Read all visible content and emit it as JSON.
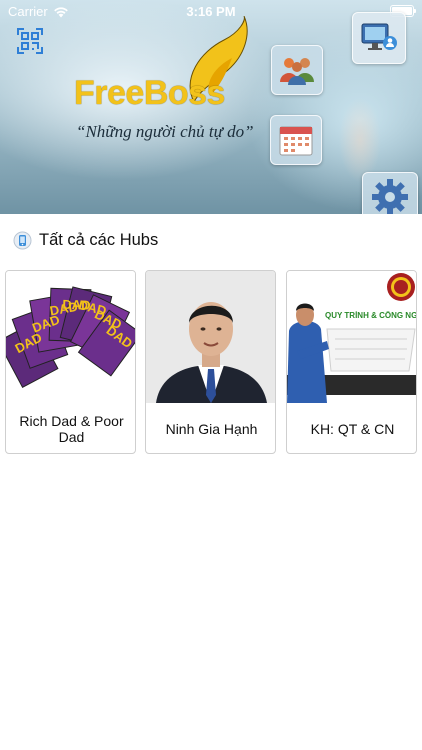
{
  "status_bar": {
    "carrier": "Carrier",
    "time": "3:16 PM"
  },
  "hero": {
    "logo_text": "FreeBoss",
    "tagline": "“Những người chủ tự do”",
    "icons": [
      "qr-scan-icon",
      "users-icon",
      "calendar-icon",
      "monitor-icon",
      "gear-icon"
    ]
  },
  "section": {
    "title": "Tất cả các Hubs",
    "icon": "hub-icon"
  },
  "hubs": [
    {
      "label": "Rich Dad & Poor Dad",
      "image": "book-covers-thumbnail"
    },
    {
      "label": "Ninh Gia Hạnh",
      "image": "portrait-thumbnail"
    },
    {
      "label": "KH: QT & CN",
      "image": "course-banner-thumbnail"
    }
  ],
  "course_banner": {
    "title": "QUY TRÌNH & CÔNG NGHỆ"
  },
  "colors": {
    "logo_yellow": "#f2c21a",
    "card_border": "#cfcfcf",
    "hub_icon_blue": "#3d8fd9"
  }
}
